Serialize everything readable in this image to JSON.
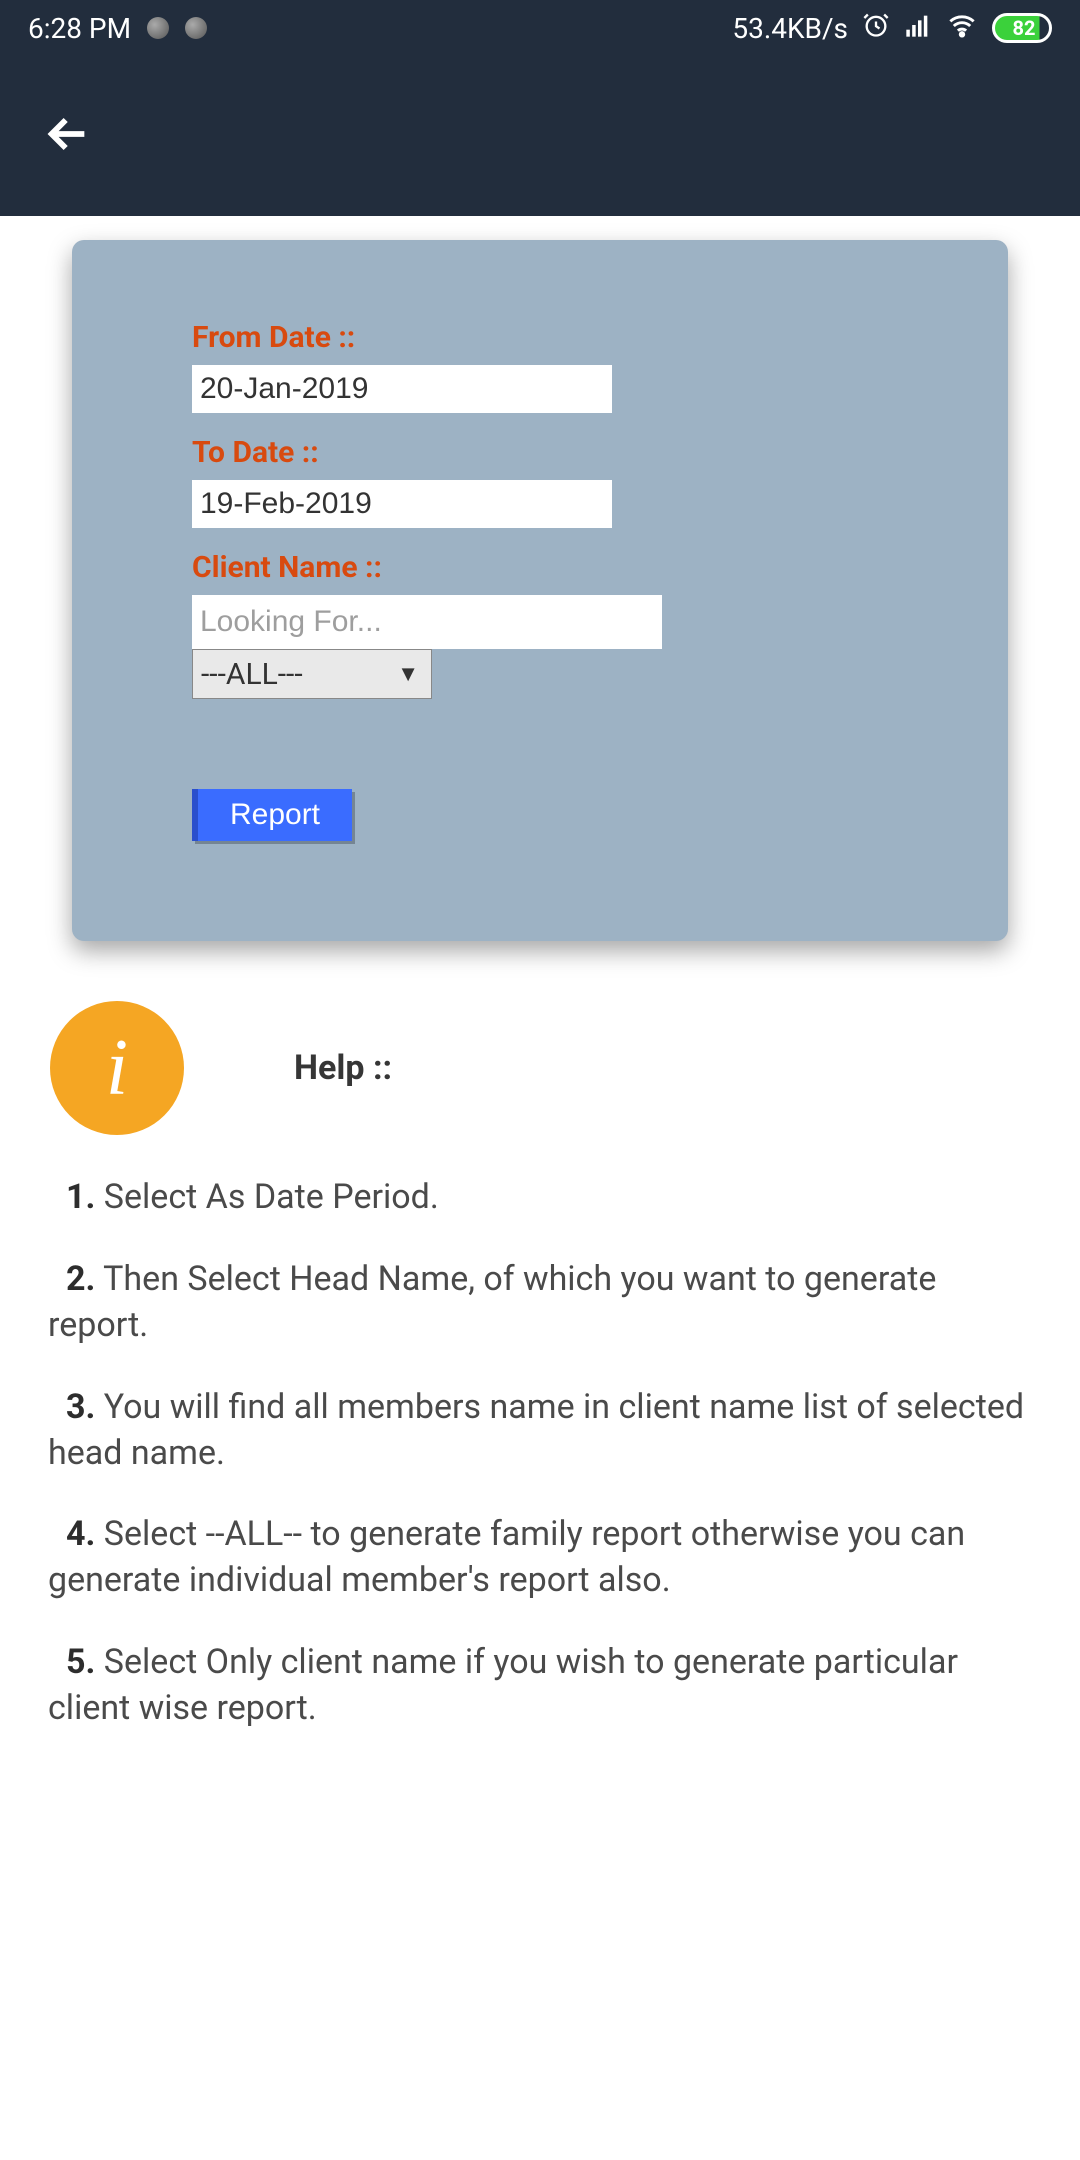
{
  "status": {
    "time": "6:28 PM",
    "net_speed": "53.4KB/s",
    "battery": "82"
  },
  "form": {
    "from_label": "From Date ::",
    "from_value": "20-Jan-2019",
    "to_label": "To Date ::",
    "to_value": "19-Feb-2019",
    "client_label": "Client Name ::",
    "client_placeholder": "Looking For...",
    "select_value": "---ALL---",
    "report_label": "Report"
  },
  "help": {
    "title": "Help ::",
    "items": [
      {
        "num": "1.",
        "text": " Select As Date Period."
      },
      {
        "num": "2.",
        "text": " Then Select Head Name, of which you want to generate report."
      },
      {
        "num": "3.",
        "text": " You will find all members name in client name list of selected head name."
      },
      {
        "num": "4.",
        "text": " Select --ALL-- to generate family report otherwise you can generate individual member's report also."
      },
      {
        "num": "5.",
        "text": " Select Only client name if you wish to generate particular client wise report."
      }
    ]
  }
}
